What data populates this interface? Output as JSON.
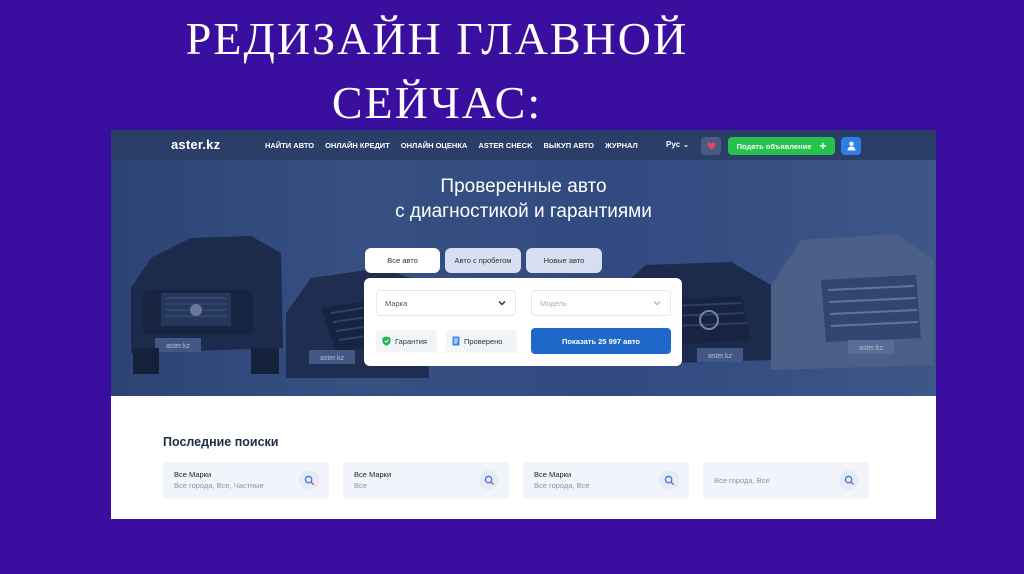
{
  "slide": {
    "title_line1": "РЕДИЗАЙН ГЛАВНОЙ",
    "title_line2": "СЕЙЧАС:"
  },
  "navbar": {
    "logo": "aster.kz",
    "links": [
      "НАЙТИ АВТО",
      "ОНЛАЙН КРЕДИТ",
      "ОНЛАЙН ОЦЕНКА",
      "ASTER CHECK",
      "ВЫКУП АВТО",
      "ЖУРНАЛ"
    ],
    "language": "Рус",
    "post_ad_label": "Подать объявление",
    "icons": {
      "favorites": "heart-icon",
      "post": "plus-icon",
      "profile": "user-icon",
      "language": "chevron-down-icon"
    }
  },
  "hero": {
    "title_line1": "Проверенные авто",
    "title_line2": "с диагностикой и гарантиями",
    "plate_text": "aster.kz",
    "tabs": [
      "Все авто",
      "Авто с пробегом",
      "Новые авто"
    ],
    "active_tab": "Все авто",
    "search": {
      "make_value": "Марка",
      "model_placeholder": "Модель",
      "chips": [
        "Гарантия",
        "Проверено"
      ],
      "submit_label": "Показать 25 997 авто"
    }
  },
  "recent_searches": {
    "title": "Последние поиски",
    "items": [
      {
        "make": "Все Марки",
        "details": "Все города, Все, Частные"
      },
      {
        "make": "Все Марки",
        "details": "Все"
      },
      {
        "make": "Все Марки",
        "details": "Все города, Все"
      },
      {
        "make": "",
        "details": "Все города, Все"
      }
    ]
  },
  "colors": {
    "slide_background": "#3a0e9e",
    "navbar": "#2b3e68",
    "accent_green": "#27c24c",
    "accent_blue": "#1f67c9",
    "favorite_heart": "#e8465a"
  }
}
